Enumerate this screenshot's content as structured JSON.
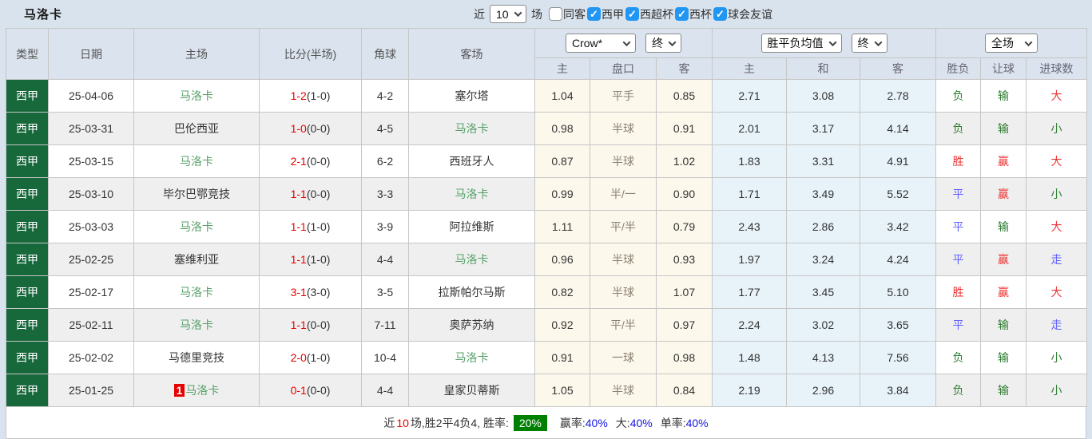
{
  "title": "马洛卡",
  "toolbar": {
    "recent_label": "近",
    "recent_value": "10",
    "games_label": "场",
    "filters": [
      {
        "label": "同客",
        "checked": false
      },
      {
        "label": "西甲",
        "checked": true
      },
      {
        "label": "西超杯",
        "checked": true
      },
      {
        "label": "西杯",
        "checked": true
      },
      {
        "label": "球会友谊",
        "checked": true
      }
    ]
  },
  "table": {
    "static_headers": [
      "类型",
      "日期",
      "主场",
      "比分(半场)",
      "角球",
      "客场"
    ],
    "dropdowns": {
      "bookmaker": "Crow*",
      "bookmaker_time": "终",
      "avg_type": "胜平负均值",
      "avg_time": "终",
      "scope": "全场"
    },
    "sub_headers": [
      "主",
      "盘口",
      "客",
      "主",
      "和",
      "客",
      "胜负",
      "让球",
      "进球数"
    ],
    "rows": [
      {
        "league": "西甲",
        "date": "25-04-06",
        "home": "马洛卡",
        "home_self": true,
        "home_badge": "",
        "score": "1-2",
        "half": "(1-0)",
        "corners": "4-2",
        "away": "塞尔塔",
        "away_self": false,
        "h_home": "1.04",
        "handicap": "平手",
        "h_away": "0.85",
        "avg_home": "2.71",
        "avg_draw": "3.08",
        "avg_away": "2.78",
        "result": "负",
        "handicap_result": "输",
        "goals": "大"
      },
      {
        "league": "西甲",
        "date": "25-03-31",
        "home": "巴伦西亚",
        "home_self": false,
        "home_badge": "",
        "score": "1-0",
        "half": "(0-0)",
        "corners": "4-5",
        "away": "马洛卡",
        "away_self": true,
        "h_home": "0.98",
        "handicap": "半球",
        "h_away": "0.91",
        "avg_home": "2.01",
        "avg_draw": "3.17",
        "avg_away": "4.14",
        "result": "负",
        "handicap_result": "输",
        "goals": "小"
      },
      {
        "league": "西甲",
        "date": "25-03-15",
        "home": "马洛卡",
        "home_self": true,
        "home_badge": "",
        "score": "2-1",
        "half": "(0-0)",
        "corners": "6-2",
        "away": "西班牙人",
        "away_self": false,
        "h_home": "0.87",
        "handicap": "半球",
        "h_away": "1.02",
        "avg_home": "1.83",
        "avg_draw": "3.31",
        "avg_away": "4.91",
        "result": "胜",
        "handicap_result": "赢",
        "goals": "大"
      },
      {
        "league": "西甲",
        "date": "25-03-10",
        "home": "毕尔巴鄂竞技",
        "home_self": false,
        "home_badge": "",
        "score": "1-1",
        "half": "(0-0)",
        "corners": "3-3",
        "away": "马洛卡",
        "away_self": true,
        "h_home": "0.99",
        "handicap": "半/一",
        "h_away": "0.90",
        "avg_home": "1.71",
        "avg_draw": "3.49",
        "avg_away": "5.52",
        "result": "平",
        "handicap_result": "赢",
        "goals": "小"
      },
      {
        "league": "西甲",
        "date": "25-03-03",
        "home": "马洛卡",
        "home_self": true,
        "home_badge": "",
        "score": "1-1",
        "half": "(1-0)",
        "corners": "3-9",
        "away": "阿拉维斯",
        "away_self": false,
        "h_home": "1.11",
        "handicap": "平/半",
        "h_away": "0.79",
        "avg_home": "2.43",
        "avg_draw": "2.86",
        "avg_away": "3.42",
        "result": "平",
        "handicap_result": "输",
        "goals": "大"
      },
      {
        "league": "西甲",
        "date": "25-02-25",
        "home": "塞维利亚",
        "home_self": false,
        "home_badge": "",
        "score": "1-1",
        "half": "(1-0)",
        "corners": "4-4",
        "away": "马洛卡",
        "away_self": true,
        "h_home": "0.96",
        "handicap": "半球",
        "h_away": "0.93",
        "avg_home": "1.97",
        "avg_draw": "3.24",
        "avg_away": "4.24",
        "result": "平",
        "handicap_result": "赢",
        "goals": "走"
      },
      {
        "league": "西甲",
        "date": "25-02-17",
        "home": "马洛卡",
        "home_self": true,
        "home_badge": "",
        "score": "3-1",
        "half": "(3-0)",
        "corners": "3-5",
        "away": "拉斯帕尔马斯",
        "away_self": false,
        "h_home": "0.82",
        "handicap": "半球",
        "h_away": "1.07",
        "avg_home": "1.77",
        "avg_draw": "3.45",
        "avg_away": "5.10",
        "result": "胜",
        "handicap_result": "赢",
        "goals": "大"
      },
      {
        "league": "西甲",
        "date": "25-02-11",
        "home": "马洛卡",
        "home_self": true,
        "home_badge": "",
        "score": "1-1",
        "half": "(0-0)",
        "corners": "7-11",
        "away": "奥萨苏纳",
        "away_self": false,
        "h_home": "0.92",
        "handicap": "平/半",
        "h_away": "0.97",
        "avg_home": "2.24",
        "avg_draw": "3.02",
        "avg_away": "3.65",
        "result": "平",
        "handicap_result": "输",
        "goals": "走"
      },
      {
        "league": "西甲",
        "date": "25-02-02",
        "home": "马德里竞技",
        "home_self": false,
        "home_badge": "",
        "score": "2-0",
        "half": "(1-0)",
        "corners": "10-4",
        "away": "马洛卡",
        "away_self": true,
        "h_home": "0.91",
        "handicap": "一球",
        "h_away": "0.98",
        "avg_home": "1.48",
        "avg_draw": "4.13",
        "avg_away": "7.56",
        "result": "负",
        "handicap_result": "输",
        "goals": "小"
      },
      {
        "league": "西甲",
        "date": "25-01-25",
        "home": "马洛卡",
        "home_self": true,
        "home_badge": "1",
        "score": "0-1",
        "half": "(0-0)",
        "corners": "4-4",
        "away": "皇家贝蒂斯",
        "away_self": false,
        "h_home": "1.05",
        "handicap": "半球",
        "h_away": "0.84",
        "avg_home": "2.19",
        "avg_draw": "2.96",
        "avg_away": "3.84",
        "result": "负",
        "handicap_result": "输",
        "goals": "小"
      }
    ]
  },
  "footer": {
    "seg1": "近",
    "games_count": "10",
    "seg2": "场,胜2平4负4, 胜率:",
    "win_rate": "20%",
    "stats": [
      {
        "label": "赢率:",
        "value": "40%"
      },
      {
        "label": "大:",
        "value": "40%"
      },
      {
        "label": "单率:",
        "value": "40%"
      }
    ]
  },
  "colors": {
    "league_cell_bg": "#17683b",
    "self_team": "#55a068",
    "win_red": "#ee3333",
    "lose_green": "#2e7d32",
    "draw_blue": "#6262ff",
    "score_red": "#e60000",
    "handicap_bg": "#fdf8ec",
    "avg_bg": "#e8f3f9",
    "header_bg": "#dae3ee",
    "checkbox_blue": "#2196f3",
    "rate_badge_bg": "#008000",
    "stat_blue": "#1515e0"
  }
}
